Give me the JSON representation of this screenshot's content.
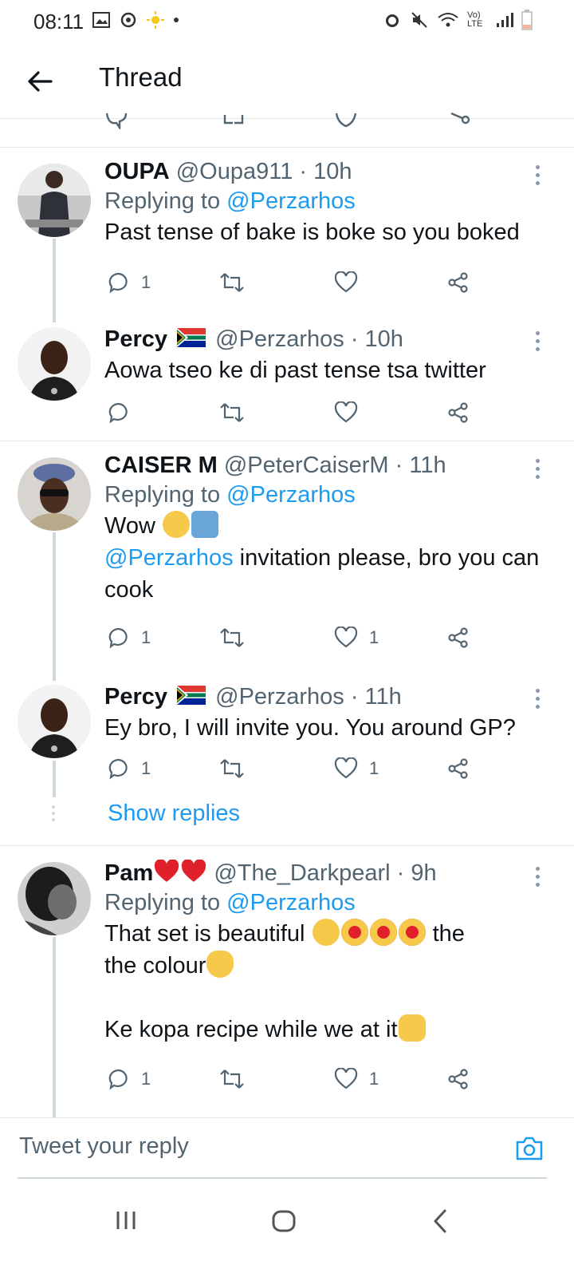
{
  "status_bar": {
    "time": "08:11",
    "network_label": "Vo) LTE",
    "colors": {
      "battery": "#f5b7a0"
    }
  },
  "header": {
    "title": "Thread"
  },
  "tweets": [
    {
      "name": "OUPA",
      "handle": "@Oupa911",
      "time": "· 10h",
      "replying_prefix": "Replying to",
      "replying_to": "@Perzarhos",
      "text": "Past tense of bake is boke so you boked",
      "replies": "1",
      "retweets": "",
      "likes": ""
    },
    {
      "name": "Percy",
      "handle": "@Perzarhos",
      "time": "· 10h",
      "text": "Aowa tseo ke di past tense tsa twitter",
      "replies": "",
      "retweets": "",
      "likes": ""
    },
    {
      "name": "CAISER M",
      "handle": "@PeterCaiserM",
      "time": "· 11h",
      "replying_prefix": "Replying to",
      "replying_to": "@Perzarhos",
      "text_line1": "Wow",
      "mention": "@Perzarhos",
      "text_rest": " invitation please, bro you can cook",
      "replies": "1",
      "retweets": "",
      "likes": "1"
    },
    {
      "name": "Percy",
      "handle": "@Perzarhos",
      "time": "· 11h",
      "text": "Ey bro, I will invite you. You around GP?",
      "replies": "1",
      "retweets": "",
      "likes": "1"
    },
    {
      "name": "Pam",
      "handle": "@The_Darkpearl",
      "time": "· 9h",
      "replying_prefix": "Replying to",
      "replying_to": "@Perzarhos",
      "text_a": "That set is beautiful",
      "text_b": "the colour",
      "text_c": "Ke kopa recipe while we at it",
      "replies": "1",
      "retweets": "",
      "likes": "1"
    }
  ],
  "show_replies": "Show replies",
  "reply_bar": {
    "placeholder": "Tweet your reply"
  },
  "colors": {
    "link": "#1d9bf0",
    "muted": "#536471",
    "thread_line": "#cfd9de"
  }
}
